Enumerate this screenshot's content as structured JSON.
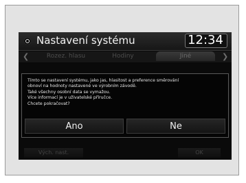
{
  "header": {
    "title": "Nastavení systému",
    "clock": "12:34"
  },
  "tabs": [
    {
      "label": "Rozez. hlasu"
    },
    {
      "label": "Hodiny"
    },
    {
      "label": "Jiné"
    }
  ],
  "dialog": {
    "lines": [
      "Tímto se nastavení systému, jako jas, hlasitost a preference směrování",
      "obnoví na hodnoty nastavené ve výrobním závodě.",
      "Také všechny osobní data se vymažou.",
      "Více informací je v uživatelské příručce.",
      "Chcete pokračovat?"
    ],
    "yes_label": "Ano",
    "no_label": "Ne"
  },
  "footer": {
    "reset_label": "Vých. nast.",
    "ok_label": "OK"
  }
}
